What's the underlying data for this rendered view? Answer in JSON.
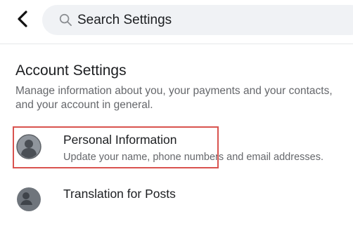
{
  "header": {
    "search_placeholder": "Search Settings"
  },
  "account_settings": {
    "title": "Account Settings",
    "description": "Manage information about you, your payments and your contacts, and your account in general."
  },
  "items": [
    {
      "title": "Personal Information",
      "subtitle": "Update your name, phone numbers and email addresses.",
      "icon": "person-icon",
      "highlighted": true
    },
    {
      "title": "Translation for Posts",
      "icon": "globe-person-icon"
    }
  ],
  "colors": {
    "highlight_border": "#d9534f",
    "search_background": "#f0f2f5",
    "secondary_text": "#65676b"
  }
}
